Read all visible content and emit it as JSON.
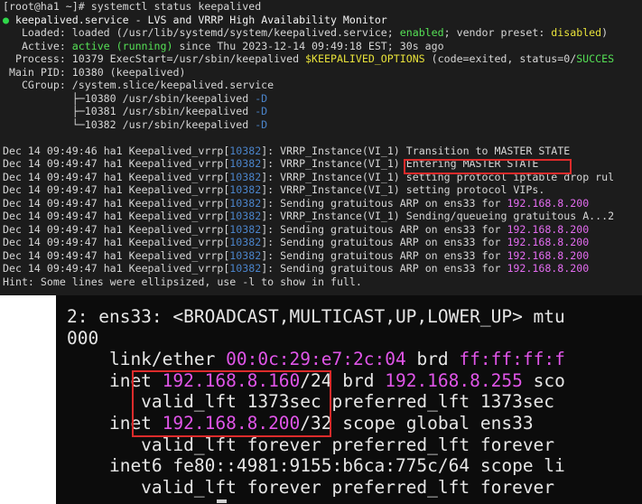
{
  "top_terminal": {
    "prompt": "[root@ha1 ~]# systemctl status keepalived",
    "unit": "keepalived.service - LVS and VRRP High Availability Monitor",
    "loaded_prefix": "   Loaded: loaded (/usr/lib/systemd/system/keepalived.service; ",
    "loaded_enabled": "enabled",
    "loaded_mid": "; vendor preset: ",
    "loaded_disabled": "disabled",
    "loaded_suffix": ")",
    "active_prefix": "   Active: ",
    "active_state": "active (running)",
    "active_suffix": " since Thu 2023-12-14 09:49:18 EST; 30s ago",
    "process_prefix": "  Process: 10379 ExecStart=/usr/sbin/keepalived ",
    "process_var": "$KEEPALIVED_OPTIONS",
    "process_suffix": " (code=exited, status=0/",
    "process_success": "SUCCES",
    "main_pid": " Main PID: 10380 (keepalived)",
    "cgroup": "   CGroup: /system.slice/keepalived.service",
    "tree": [
      "           ├─10380 /usr/sbin/keepalived ",
      "           ├─10381 /usr/sbin/keepalived ",
      "           └─10382 /usr/sbin/keepalived "
    ],
    "tree_flag": "-D",
    "log_host": "ha1 Keepalived_vrrp",
    "log_pid": "10382",
    "logs": [
      {
        "ts": "Dec 14 09:49:46",
        "pre": "VRRP_Instance(VI_1) Transition to MASTER STATE",
        "ip": ""
      },
      {
        "ts": "Dec 14 09:49:47",
        "pre": "VRRP_Instance(VI_1) Entering MASTER STATE",
        "ip": ""
      },
      {
        "ts": "Dec 14 09:49:47",
        "pre": "VRRP_Instance(VI_1) setting protocol iptable drop rul",
        "ip": ""
      },
      {
        "ts": "Dec 14 09:49:47",
        "pre": "VRRP_Instance(VI_1) setting protocol VIPs.",
        "ip": ""
      },
      {
        "ts": "Dec 14 09:49:47",
        "pre": "Sending gratuitous ARP on ens33 for ",
        "ip": "192.168.8.200"
      },
      {
        "ts": "Dec 14 09:49:47",
        "pre": "VRRP_Instance(VI_1) Sending/queueing gratuitous A...2",
        "ip": ""
      },
      {
        "ts": "Dec 14 09:49:47",
        "pre": "Sending gratuitous ARP on ens33 for ",
        "ip": "192.168.8.200"
      },
      {
        "ts": "Dec 14 09:49:47",
        "pre": "Sending gratuitous ARP on ens33 for ",
        "ip": "192.168.8.200"
      },
      {
        "ts": "Dec 14 09:49:47",
        "pre": "Sending gratuitous ARP on ens33 for ",
        "ip": "192.168.8.200"
      },
      {
        "ts": "Dec 14 09:49:47",
        "pre": "Sending gratuitous ARP on ens33 for ",
        "ip": "192.168.8.200"
      }
    ],
    "hint": "Hint: Some lines were ellipsized, use -l to show in full."
  },
  "bottom_terminal": {
    "l1": "2: ens33: <BROADCAST,MULTICAST,UP,LOWER_UP> mtu",
    "l2": "000",
    "l3_pre": "    link/ether ",
    "l3_mac": "00:0c:29:e7:2c:04",
    "l3_mid": " brd ",
    "l3_brd": "ff:ff:ff:f",
    "l4_pre": "    inet ",
    "l4_ip": "192.168.8.160",
    "l4_mid": "/24 brd ",
    "l4_brd": "192.168.8.255",
    "l4_suf": " sco",
    "l5": "       valid_lft 1373sec preferred_lft 1373sec",
    "l6_pre": "    inet ",
    "l6_ip": "192.168.8.200",
    "l6_suf": "/32 scope global ens33",
    "l7": "       valid_lft forever preferred_lft forever",
    "l8": "    inet6 fe80::4981:9155:b6ca:775c/64 scope li",
    "l9": "       valid_lft forever preferred_lft forever"
  },
  "colors": {
    "enabled": "#55e055",
    "ip_magenta": "#e055e8",
    "pid_blue": "#4a83c9",
    "highlight_red": "#e02424"
  }
}
